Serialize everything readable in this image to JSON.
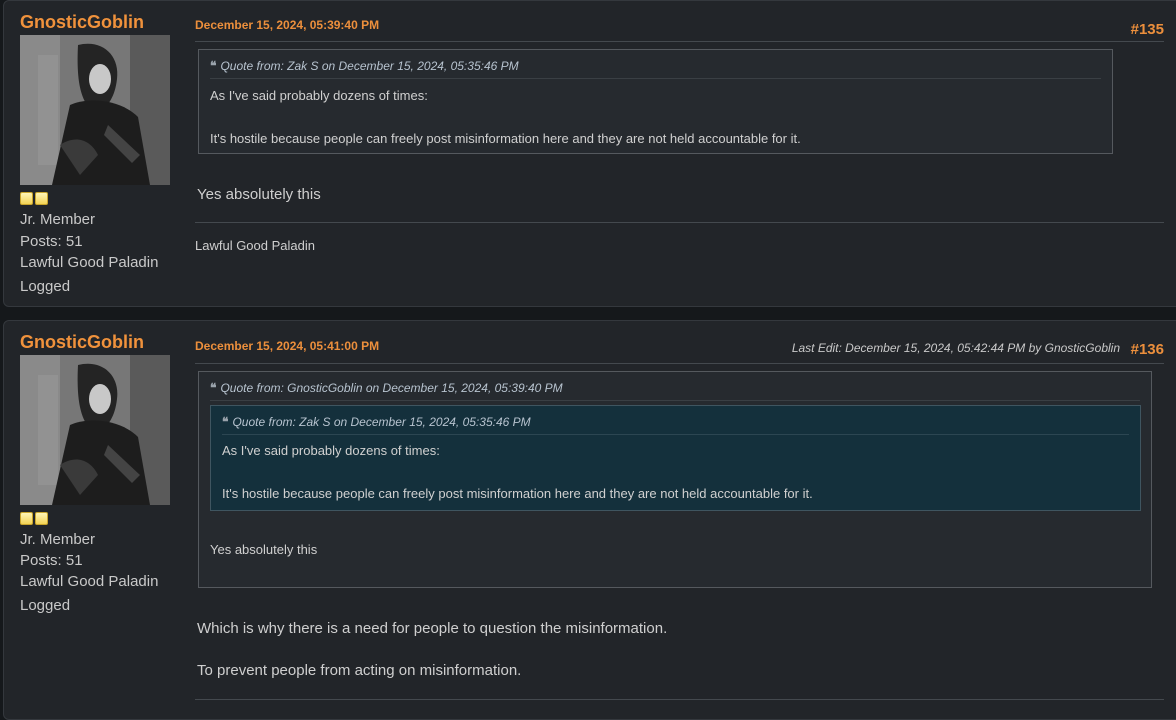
{
  "posts": [
    {
      "author": "GnosticGoblin",
      "rank": "Jr. Member",
      "posts": "Posts: 51",
      "title": "Lawful Good Paladin",
      "logged": "Logged",
      "date": "December 15, 2024, 05:39:40 PM",
      "number": "#135",
      "quote": {
        "header": "Quote from: Zak S on December 15, 2024, 05:35:46 PM",
        "lines": [
          "As I've said probably dozens of times:",
          "It's hostile because people can freely post misinformation here and they are not held accountable for it."
        ]
      },
      "body": [
        "Yes absolutely this"
      ],
      "signature": "Lawful Good Paladin"
    },
    {
      "author": "GnosticGoblin",
      "rank": "Jr. Member",
      "posts": "Posts: 51",
      "title": "Lawful Good Paladin",
      "logged": "Logged",
      "date": "December 15, 2024, 05:41:00 PM",
      "number": "#136",
      "last_edit": "Last Edit: December 15, 2024, 05:42:44 PM by GnosticGoblin",
      "quote": {
        "header": "Quote from: GnosticGoblin on December 15, 2024, 05:39:40 PM",
        "inner_quote": {
          "header": "Quote from: Zak S on December 15, 2024, 05:35:46 PM",
          "lines": [
            "As I've said probably dozens of times:",
            "It's hostile because people can freely post misinformation here and they are not held accountable for it."
          ]
        },
        "lines": [
          "Yes absolutely this"
        ]
      },
      "body": [
        "Which is why there is a need for people to question the misinformation.",
        "To prevent people from acting on misinformation."
      ]
    }
  ],
  "icons": {
    "quote": "quote-icon",
    "rank_star": "rank-star-icon"
  },
  "colors": {
    "page_background": "#15181b",
    "post_background": "#222529",
    "accent": "#ec8f3c",
    "inner_quote_background": "#14303c"
  }
}
